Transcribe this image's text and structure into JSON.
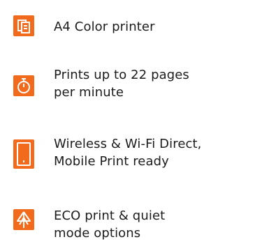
{
  "accent_color": "#f26a1b",
  "features": [
    {
      "icon": "document-copy-icon",
      "line1": "A4 Color printer",
      "line2": ""
    },
    {
      "icon": "stopwatch-icon",
      "line1": "Prints up to 22 pages",
      "line2": "per minute"
    },
    {
      "icon": "mobile-phone-icon",
      "line1": "Wireless & Wi-Fi Direct,",
      "line2": "Mobile Print ready"
    },
    {
      "icon": "eco-tree-icon",
      "line1": "ECO print & quiet",
      "line2": "mode options"
    }
  ]
}
